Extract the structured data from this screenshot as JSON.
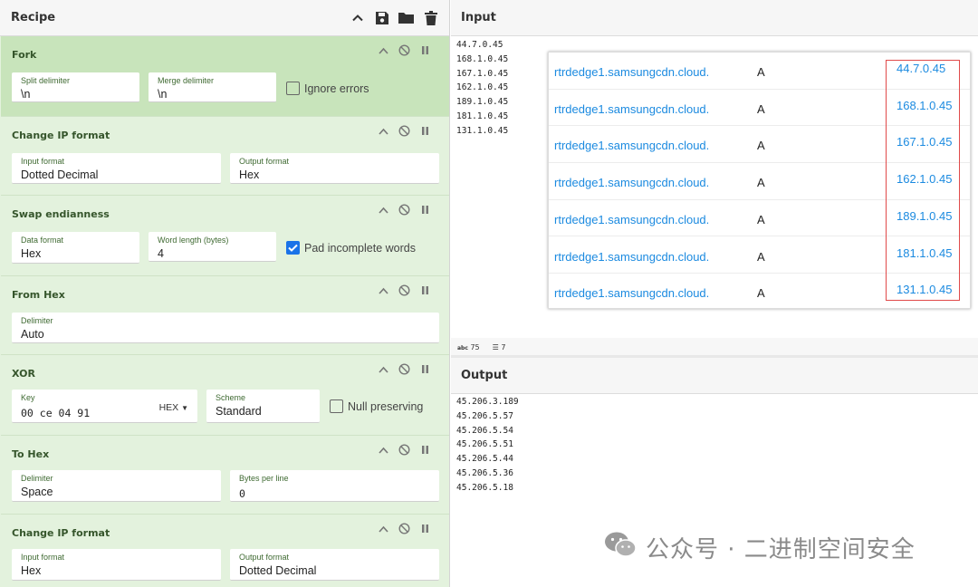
{
  "recipe": {
    "title": "Recipe",
    "operations": [
      {
        "title": "Fork",
        "fields": [
          {
            "label": "Split delimiter",
            "value": "\\n"
          },
          {
            "label": "Merge delimiter",
            "value": "\\n"
          }
        ],
        "checkbox": {
          "label": "Ignore errors",
          "checked": false
        }
      },
      {
        "title": "Change IP format",
        "fields": [
          {
            "label": "Input format",
            "value": "Dotted Decimal"
          },
          {
            "label": "Output format",
            "value": "Hex"
          }
        ]
      },
      {
        "title": "Swap endianness",
        "fields": [
          {
            "label": "Data format",
            "value": "Hex"
          },
          {
            "label": "Word length (bytes)",
            "value": "4"
          }
        ],
        "checkbox": {
          "label": "Pad incomplete words",
          "checked": true
        }
      },
      {
        "title": "From Hex",
        "fields": [
          {
            "label": "Delimiter",
            "value": "Auto"
          }
        ]
      },
      {
        "title": "XOR",
        "fields": [
          {
            "label": "Key",
            "value": "00 ce 04 91",
            "dropdown": "HEX"
          },
          {
            "label": "Scheme",
            "value": "Standard"
          }
        ],
        "checkbox": {
          "label": "Null preserving",
          "checked": false
        }
      },
      {
        "title": "To Hex",
        "fields": [
          {
            "label": "Delimiter",
            "value": "Space"
          },
          {
            "label": "Bytes per line",
            "value": "0"
          }
        ]
      },
      {
        "title": "Change IP format",
        "fields": [
          {
            "label": "Input format",
            "value": "Hex"
          },
          {
            "label": "Output format",
            "value": "Dotted Decimal"
          }
        ]
      }
    ]
  },
  "input": {
    "title": "Input",
    "lines": [
      "44.7.0.45",
      "168.1.0.45",
      "167.1.0.45",
      "162.1.0.45",
      "189.1.0.45",
      "181.1.0.45",
      "131.1.0.45"
    ],
    "status_chars": "75",
    "status_lines": "7"
  },
  "output": {
    "title": "Output",
    "lines": [
      "45.206.3.189",
      "45.206.5.57",
      "45.206.5.54",
      "45.206.5.51",
      "45.206.5.44",
      "45.206.5.36",
      "45.206.5.18"
    ]
  },
  "dns_records": [
    {
      "host": "rtrdedge1.samsungcdn.cloud.",
      "type": "A",
      "ip": "44.7.0.45"
    },
    {
      "host": "rtrdedge1.samsungcdn.cloud.",
      "type": "A",
      "ip": "168.1.0.45"
    },
    {
      "host": "rtrdedge1.samsungcdn.cloud.",
      "type": "A",
      "ip": "167.1.0.45"
    },
    {
      "host": "rtrdedge1.samsungcdn.cloud.",
      "type": "A",
      "ip": "162.1.0.45"
    },
    {
      "host": "rtrdedge1.samsungcdn.cloud.",
      "type": "A",
      "ip": "189.1.0.45"
    },
    {
      "host": "rtrdedge1.samsungcdn.cloud.",
      "type": "A",
      "ip": "181.1.0.45"
    },
    {
      "host": "rtrdedge1.samsungcdn.cloud.",
      "type": "A",
      "ip": "131.1.0.45"
    }
  ],
  "watermark": "公众号 · 二进制空间安全",
  "colors": {
    "accent": "#1a73e8",
    "link": "#1b8ae0",
    "highlight_border": "#e04a4a",
    "op_bg": "#e3f2dd",
    "op_selected_bg": "#c8e4bb"
  }
}
